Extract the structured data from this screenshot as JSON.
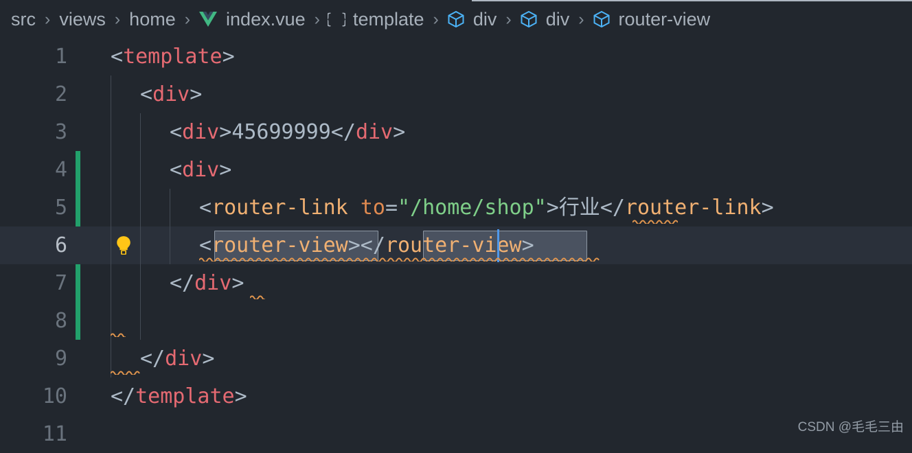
{
  "window": {
    "background": "#22272e",
    "line_height": 55,
    "char_width": 21.7
  },
  "breadcrumb": {
    "name": "breadcrumb",
    "items": [
      {
        "label": "src",
        "icon": ""
      },
      {
        "label": "views",
        "icon": ""
      },
      {
        "label": "home",
        "icon": ""
      },
      {
        "label": "index.vue",
        "icon": "vue-file-icon"
      },
      {
        "label": "template",
        "icon": "braces-icon"
      },
      {
        "label": "div",
        "icon": "cube-icon"
      },
      {
        "label": "div",
        "icon": "cube-icon"
      },
      {
        "label": "router-view",
        "icon": "cube-icon"
      }
    ],
    "separator": "›"
  },
  "editor": {
    "current_line": 6,
    "git_change_lines": [
      4,
      8
    ],
    "lightbulb_line": 6,
    "cursor": {
      "line": 6,
      "column": 21
    },
    "lines": [
      {
        "no": "1",
        "text": "<template>"
      },
      {
        "no": "2",
        "text": "  <div>"
      },
      {
        "no": "3",
        "text": "    <div>45699999</div>"
      },
      {
        "no": "4",
        "text": "    <div>"
      },
      {
        "no": "5",
        "text": "      <router-link to=\"/home/shop\">行业</router-link>"
      },
      {
        "no": "6",
        "text": "      <router-view></router-view>"
      },
      {
        "no": "7",
        "text": "    </div>"
      },
      {
        "no": "8",
        "text": ""
      },
      {
        "no": "9",
        "text": "  </div>"
      },
      {
        "no": "10",
        "text": "</template>"
      },
      {
        "no": "11",
        "text": ""
      }
    ],
    "selection_text": "router-view",
    "colors": {
      "tag": "#e56a72",
      "component": "#f0b072",
      "attribute": "#e08a50",
      "string": "#7fcf89",
      "punctuation": "#adbac7",
      "line_number": "#6a737d",
      "current_line_bg": "#2a303a",
      "git_added": "#22a06b",
      "selection_bg": "#4a5260",
      "caret": "#4f97e8",
      "squiggle": "#e0954e",
      "indent_guide": "#434a54"
    }
  },
  "watermark": {
    "text": "CSDN @毛毛三由"
  }
}
